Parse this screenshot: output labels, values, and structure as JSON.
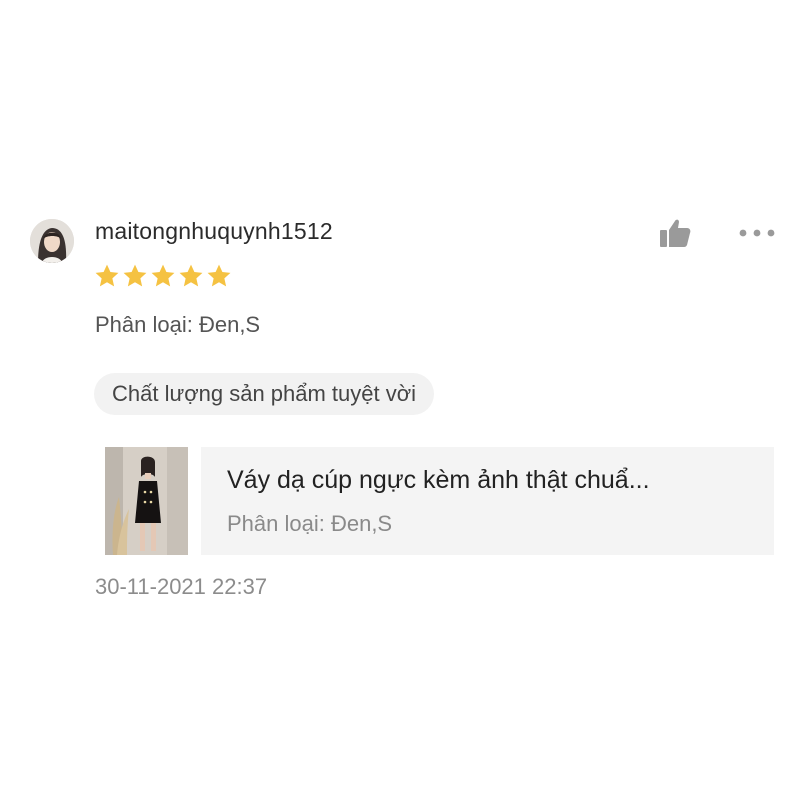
{
  "review": {
    "username": "maitongnhuquynh1512",
    "rating": 5,
    "rating_max": 5,
    "variant_text": "Phân loại: Đen,S",
    "tag": "Chất lượng sản phẩm tuyệt vời",
    "timestamp": "30-11-2021 22:37"
  },
  "product": {
    "title": "Váy dạ cúp ngực kèm ảnh thật chuẩ...",
    "variant_text": "Phân loại: Đen,S"
  },
  "icons": {
    "like": "thumbs-up-icon",
    "more": "more-options-icon",
    "star": "star-icon"
  },
  "colors": {
    "star": "#f5c242",
    "icon_gray": "#9a9a9a",
    "card_bg": "#f4f4f4",
    "tag_bg": "#f2f2f2"
  }
}
